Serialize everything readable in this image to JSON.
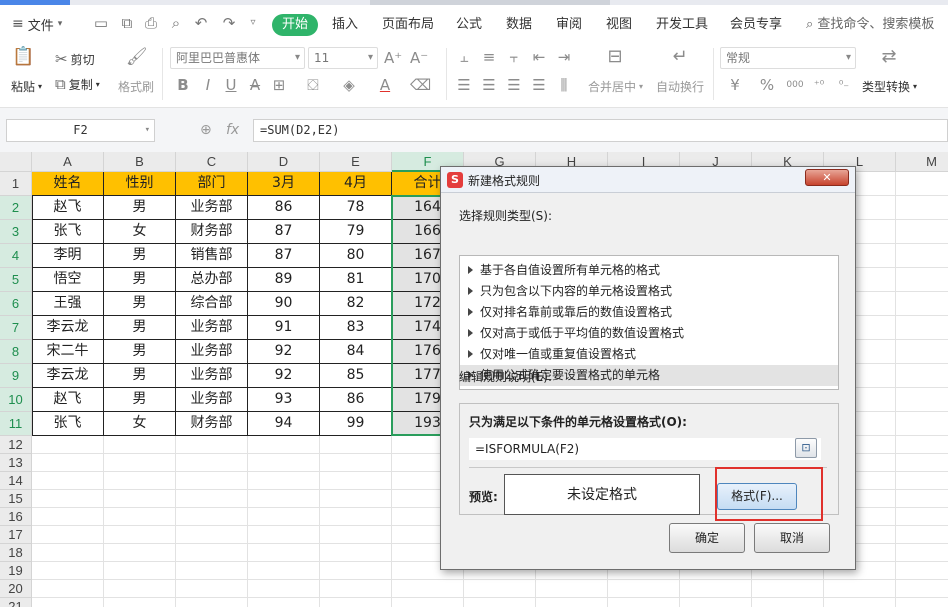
{
  "menu": {
    "file_label": "文件",
    "tabs": [
      "开始",
      "插入",
      "页面布局",
      "公式",
      "数据",
      "审阅",
      "视图",
      "开发工具",
      "会员专享"
    ],
    "search_placeholder": "查找命令、搜索模板",
    "accent_color": "#2fb46a"
  },
  "ribbon": {
    "paste": "粘贴",
    "cut": "剪切",
    "copy": "复制",
    "format_painter": "格式刷",
    "font_name": "阿里巴巴普惠体",
    "font_size": "11",
    "merge_center": "合并居中",
    "wrap_text": "自动换行",
    "number_format": "常规",
    "type_convert": "类型转换",
    "currency_symbol": "¥",
    "percent_symbol": "%",
    "thousand_symbol": "000",
    "bold": "B",
    "italic": "I",
    "underline": "U",
    "strike": "A",
    "font_color_letter": "A",
    "grow_font": "A⁺",
    "shrink_font": "A⁻"
  },
  "formula_bar": {
    "name_box": "F2",
    "fx_label": "fx",
    "formula": "=SUM(D2,E2)"
  },
  "sheet": {
    "columns": [
      "A",
      "B",
      "C",
      "D",
      "E",
      "F",
      "G",
      "H",
      "I",
      "J",
      "K",
      "L",
      "M"
    ],
    "row_numbers": [
      "1",
      "2",
      "3",
      "4",
      "5",
      "6",
      "7",
      "8",
      "9",
      "10",
      "11",
      "12",
      "13",
      "14",
      "15",
      "16",
      "17",
      "18",
      "19",
      "20",
      "21"
    ],
    "header_row": [
      "姓名",
      "性别",
      "部门",
      "3月",
      "4月",
      "合计"
    ],
    "rows": [
      [
        "赵飞",
        "男",
        "业务部",
        "86",
        "78",
        "164"
      ],
      [
        "张飞",
        "女",
        "财务部",
        "87",
        "79",
        "166"
      ],
      [
        "李明",
        "男",
        "销售部",
        "87",
        "80",
        "167"
      ],
      [
        "悟空",
        "男",
        "总办部",
        "89",
        "81",
        "170"
      ],
      [
        "王强",
        "男",
        "综合部",
        "90",
        "82",
        "172"
      ],
      [
        "李云龙",
        "男",
        "业务部",
        "91",
        "83",
        "174"
      ],
      [
        "宋二牛",
        "男",
        "业务部",
        "92",
        "84",
        "176"
      ],
      [
        "李云龙",
        "男",
        "业务部",
        "92",
        "85",
        "177"
      ],
      [
        "赵飞",
        "男",
        "业务部",
        "93",
        "86",
        "179"
      ],
      [
        "张飞",
        "女",
        "财务部",
        "94",
        "99",
        "193"
      ]
    ],
    "header_fill": "#ffc000",
    "selection_color": "#2a9d5c"
  },
  "dialog": {
    "title": "新建格式规则",
    "logo": "S",
    "close": "✕",
    "select_type_label": "选择规则类型(S):",
    "rule_types": [
      "基于各自值设置所有单元格的格式",
      "只为包含以下内容的单元格设置格式",
      "仅对排名靠前或靠后的数值设置格式",
      "仅对高于或低于平均值的数值设置格式",
      "仅对唯一值或重复值设置格式",
      "使用公式确定要设置格式的单元格"
    ],
    "edit_desc_label": "编辑规则说明(E):",
    "condition_label": "只为满足以下条件的单元格设置格式(O):",
    "condition_value": "=ISFORMULA(F2)",
    "preview_label": "预览:",
    "preview_text": "未设定格式",
    "format_button": "格式(F)...",
    "ok_button": "确定",
    "cancel_button": "取消",
    "highlight_color": "#e0312c"
  }
}
